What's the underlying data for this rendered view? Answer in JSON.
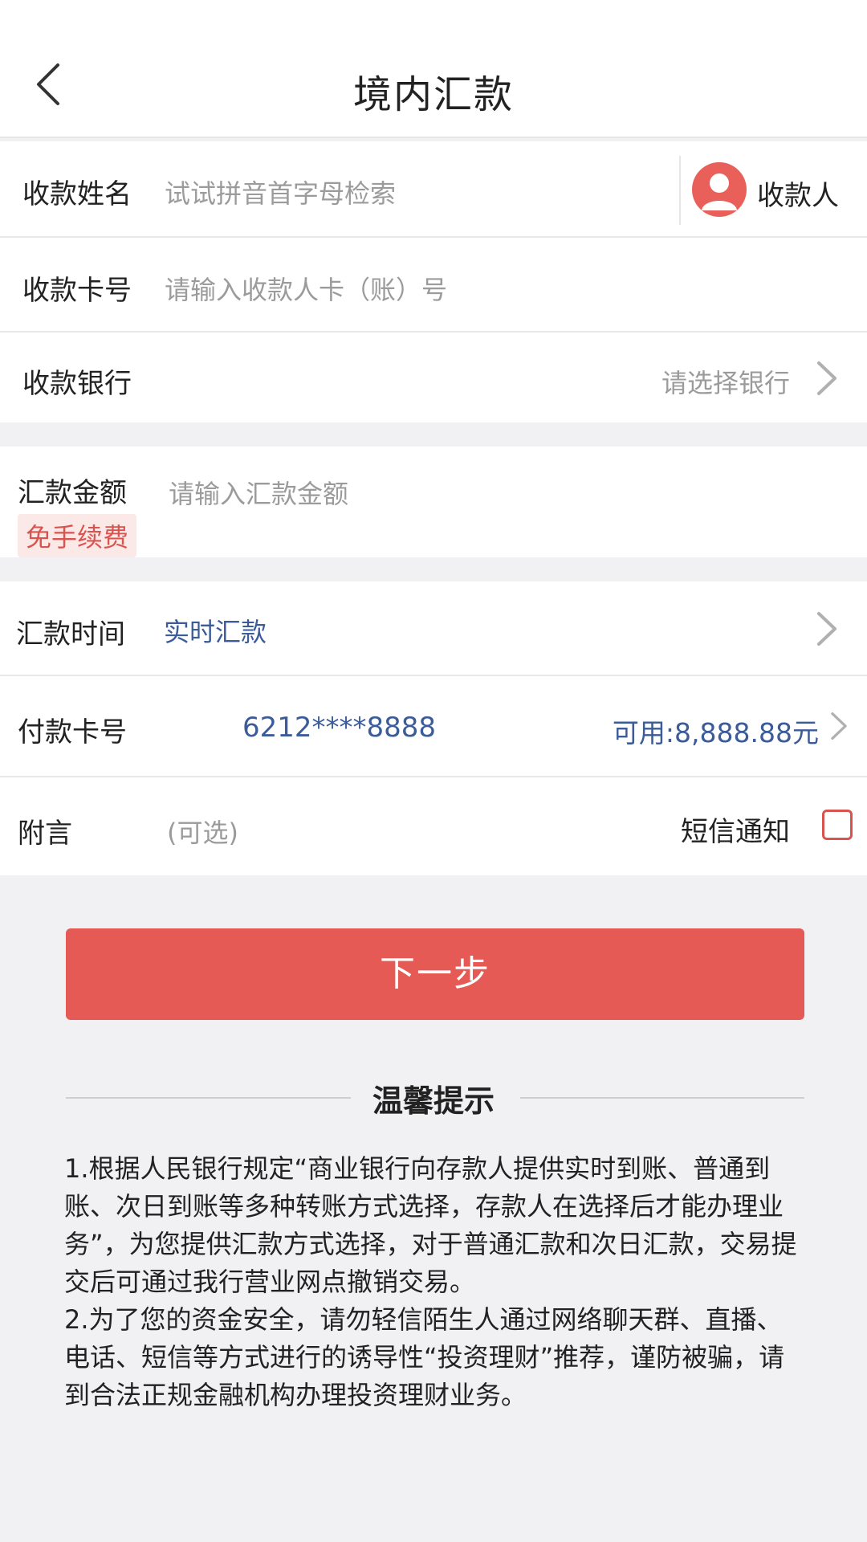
{
  "header": {
    "title": "境内汇款"
  },
  "form": {
    "payee_name": {
      "label": "收款姓名",
      "placeholder": "试试拼音首字母检索",
      "payee_button": "收款人"
    },
    "card_number": {
      "label": "收款卡号",
      "placeholder": "请输入收款人卡（账）号"
    },
    "bank": {
      "label": "收款银行",
      "value": "请选择银行"
    },
    "amount": {
      "label": "汇款金额",
      "badge": "免手续费",
      "placeholder": "请输入汇款金额"
    },
    "time": {
      "label": "汇款时间",
      "value": "实时汇款"
    },
    "pay_card": {
      "label": "付款卡号",
      "card": "6212****8888",
      "balance": "可用:8,888.88元"
    },
    "memo": {
      "label": "附言",
      "placeholder": "(可选)",
      "sms_label": "短信通知"
    }
  },
  "next_button": "下一步",
  "tips": {
    "title": "温馨提示",
    "items": [
      "1.根据人民银行规定“商业银行向存款人提供实时到账、普通到账、次日到账等多种转账方式选择，存款人在选择后才能办理业务”，为您提供汇款方式选择，对于普通汇款和次日汇款，交易提交后可通过我行营业网点撤销交易。",
      "2.为了您的资金安全，请勿轻信陌生人通过网络聊天群、直播、电话、短信等方式进行的诱导性“投资理财”推荐，谨防被骗，请到合法正规金融机构办理投资理财业务。"
    ]
  },
  "colors": {
    "accent": "#e55a55",
    "link_blue": "#3b5b99",
    "background": "#f1f1f3"
  }
}
